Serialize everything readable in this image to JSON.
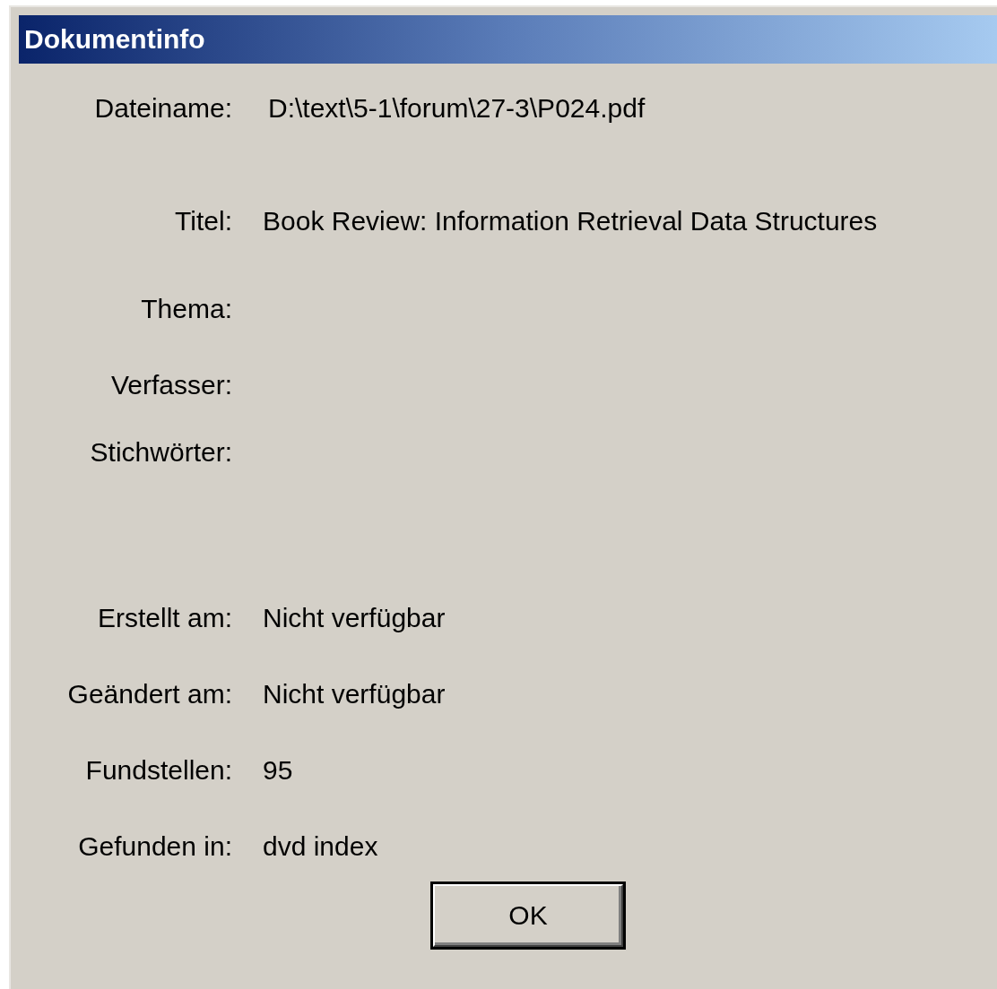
{
  "window": {
    "title": "Dokumentinfo"
  },
  "fields": [
    {
      "label": "Dateiname:",
      "value": "D:\\text\\5-1\\forum\\27-3\\P024.pdf"
    },
    {
      "label": "Titel:",
      "value": "Book Review: Information Retrieval Data Structures"
    },
    {
      "label": "Thema:"
    },
    {
      "label": "Verfasser:"
    },
    {
      "label": "Stichwörter:"
    },
    {
      "label": "Erstellt am:",
      "value": "Nicht verfügbar"
    },
    {
      "label": "Geändert am:",
      "value": "Nicht verfügbar"
    },
    {
      "label": "Fundstellen:",
      "value": "95"
    },
    {
      "label": "Gefunden in:",
      "value": "dvd index"
    }
  ],
  "buttons": [
    "OK"
  ]
}
